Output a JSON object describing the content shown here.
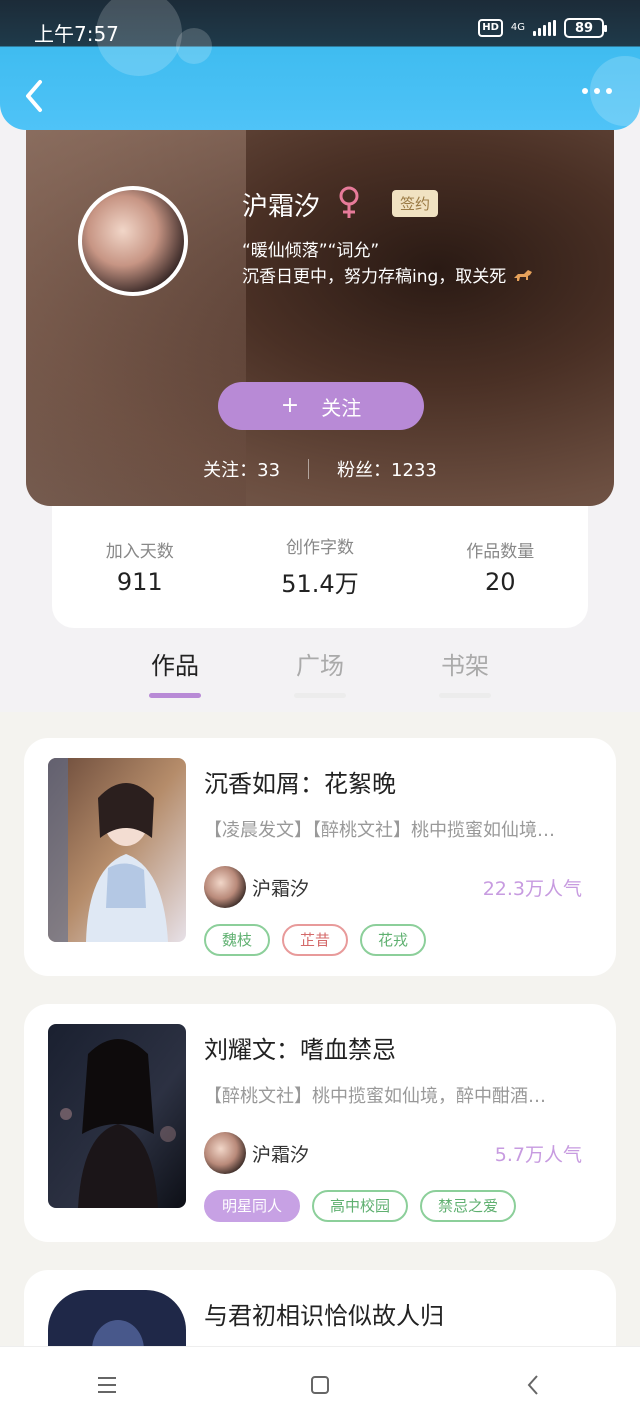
{
  "status_bar": {
    "time": "上午7:57",
    "hd": "HD",
    "network": "4G",
    "battery": "89"
  },
  "profile": {
    "nickname": "沪霜汐",
    "signed_badge": "签约",
    "bio_line1": "“暖仙倾落”“词允”",
    "bio_line2": "沉香日更中，努力存稿ing，取关死",
    "follow_button": "关注",
    "following_label": "关注：33",
    "fans_label": "粉丝：1233"
  },
  "stats": [
    {
      "label": "加入天数",
      "value": "911"
    },
    {
      "label": "创作字数",
      "value": "51.4万"
    },
    {
      "label": "作品数量",
      "value": "20"
    }
  ],
  "tabs": [
    "作品",
    "广场",
    "书架"
  ],
  "active_tab": "作品",
  "books": [
    {
      "title": "沉香如屑：花絮晚",
      "desc": "【凌晨发文】【醉桃文社】桃中揽蜜如仙境…",
      "author": "沪霜汐",
      "popularity": "22.3万人气",
      "tags": [
        {
          "label": "魏枝",
          "style": "green"
        },
        {
          "label": "芷昔",
          "style": "red"
        },
        {
          "label": "花戎",
          "style": "green"
        }
      ]
    },
    {
      "title": "刘耀文：嗜血禁忌",
      "desc": "【醉桃文社】桃中揽蜜如仙境，醉中酣酒…",
      "author": "沪霜汐",
      "popularity": "5.7万人气",
      "tags": [
        {
          "label": "明星同人",
          "style": "purple"
        },
        {
          "label": "高中校园",
          "style": "green"
        },
        {
          "label": "禁忌之爱",
          "style": "green"
        }
      ]
    },
    {
      "title": "与君初相识恰似故人归"
    }
  ],
  "colors": {
    "accent": "#b88ad6",
    "header": "#4fc3f7",
    "popularity": "#c79be0"
  }
}
